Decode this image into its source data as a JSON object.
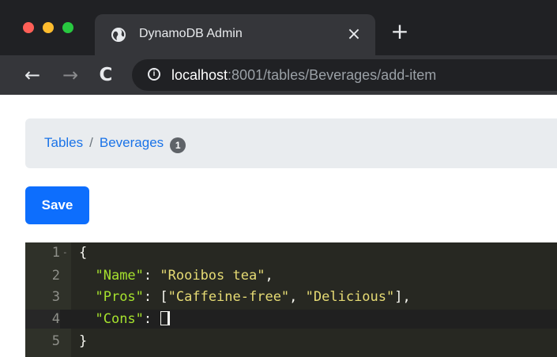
{
  "browser": {
    "tab": {
      "title": "DynamoDB Admin",
      "close": "×"
    },
    "new_tab": "+",
    "nav": {
      "back": "←",
      "forward": "→",
      "reload": "C"
    },
    "address": {
      "host": "localhost",
      "rest": ":8001/tables/Beverages/add-item"
    }
  },
  "breadcrumb": {
    "items": [
      "Tables",
      "Beverages"
    ],
    "separator": "/",
    "badge": "1"
  },
  "toolbar": {
    "save_label": "Save"
  },
  "editor": {
    "lines": [
      {
        "num": "1",
        "fold": "-",
        "text": "{"
      },
      {
        "num": "2",
        "key": "\"Name\"",
        "colon": ": ",
        "value": "\"Rooibos tea\"",
        "tail": ","
      },
      {
        "num": "3",
        "key": "\"Pros\"",
        "colon": ": ",
        "open": "[",
        "v1": "\"Caffeine-free\"",
        "comma": ", ",
        "v2": "\"Delicious\"",
        "close": "],",
        "tail": ""
      },
      {
        "num": "4",
        "key": "\"Cons\"",
        "colon": ": ",
        "bracket": "[]"
      },
      {
        "num": "5",
        "text": "}"
      }
    ]
  },
  "colors": {
    "accent": "#0d6efd",
    "editor_bg": "#272822",
    "json_key": "#a6e22e",
    "json_string": "#e6db74"
  }
}
